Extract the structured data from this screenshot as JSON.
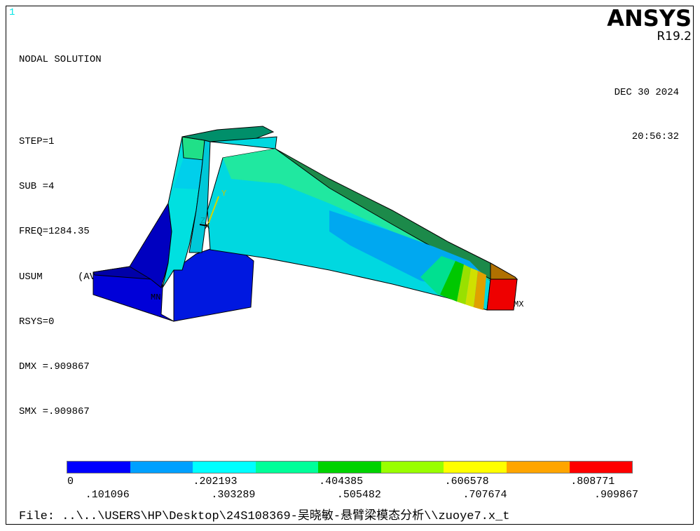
{
  "window_number": "1",
  "info": {
    "title": "NODAL SOLUTION",
    "step": "STEP=1",
    "sub": "SUB =4",
    "freq": "FREQ=1284.35",
    "usum": "USUM      (AVG)",
    "rsys": "RSYS=0",
    "dmx": "DMX =.909867",
    "smx": "SMX =.909867"
  },
  "brand": {
    "logo": "ANSYS",
    "version": "R19.2"
  },
  "datetime": {
    "date": "DEC 30 2024",
    "time": "20:56:32"
  },
  "model_labels": {
    "min": "MN",
    "max": "MX",
    "axis_y": "Y",
    "axis_z": "Z",
    "axis_x": "X"
  },
  "legend": {
    "colors": [
      "#0000ff",
      "#00a0ff",
      "#00ffff",
      "#00ff99",
      "#00d200",
      "#99ff00",
      "#ffff00",
      "#ffa500",
      "#ff0000"
    ],
    "top_ticks": [
      "0",
      ".202193",
      ".404385",
      ".606578",
      ".808771"
    ],
    "bottom_ticks": [
      ".101096",
      ".303289",
      ".505482",
      ".707674",
      ".909867"
    ]
  },
  "file_path": "File: ..\\..\\USERS\\HP\\Desktop\\24S108369-吴晓敏-悬臂梁模态分析\\\\zuoye7.x_t"
}
